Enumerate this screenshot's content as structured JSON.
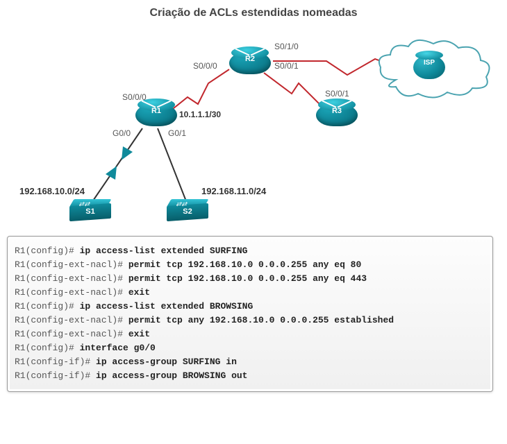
{
  "title": "Criação de ACLs estendidas nomeadas",
  "nodes": {
    "r1": "R1",
    "r2": "R2",
    "r3": "R3",
    "s1": "S1",
    "s2": "S2",
    "isp": "ISP"
  },
  "if_labels": {
    "r1_s000": "S0/0/0",
    "r1_g00": "G0/0",
    "r1_g01": "G0/1",
    "r2_s000": "S0/0/0",
    "r2_s010": "S0/1/0",
    "r2_s001": "S0/0/1",
    "r3_s001": "S0/0/1"
  },
  "addrs": {
    "r1_r2": "10.1.1.1/30",
    "net_s1": "192.168.10.0/24",
    "net_s2": "192.168.11.0/24"
  },
  "cli": [
    {
      "prompt": "R1(config)# ",
      "cmd": "ip access-list extended SURFING"
    },
    {
      "prompt": "R1(config-ext-nacl)# ",
      "cmd": "permit tcp 192.168.10.0 0.0.0.255 any eq 80"
    },
    {
      "prompt": "R1(config-ext-nacl)# ",
      "cmd": "permit tcp 192.168.10.0 0.0.0.255 any eq 443"
    },
    {
      "prompt": "R1(config-ext-nacl)# ",
      "cmd": "exit"
    },
    {
      "prompt": "R1(config)# ",
      "cmd": "ip access-list extended BROWSING"
    },
    {
      "prompt": "R1(config-ext-nacl)# ",
      "cmd": "permit tcp any 192.168.10.0 0.0.0.255 established"
    },
    {
      "prompt": "R1(config-ext-nacl)# ",
      "cmd": "exit"
    },
    {
      "prompt": "R1(config)# ",
      "cmd": "interface g0/0"
    },
    {
      "prompt": "R1(config-if)# ",
      "cmd": "ip access-group SURFING in"
    },
    {
      "prompt": "R1(config-if)# ",
      "cmd": "ip access-group BROWSING out"
    }
  ]
}
